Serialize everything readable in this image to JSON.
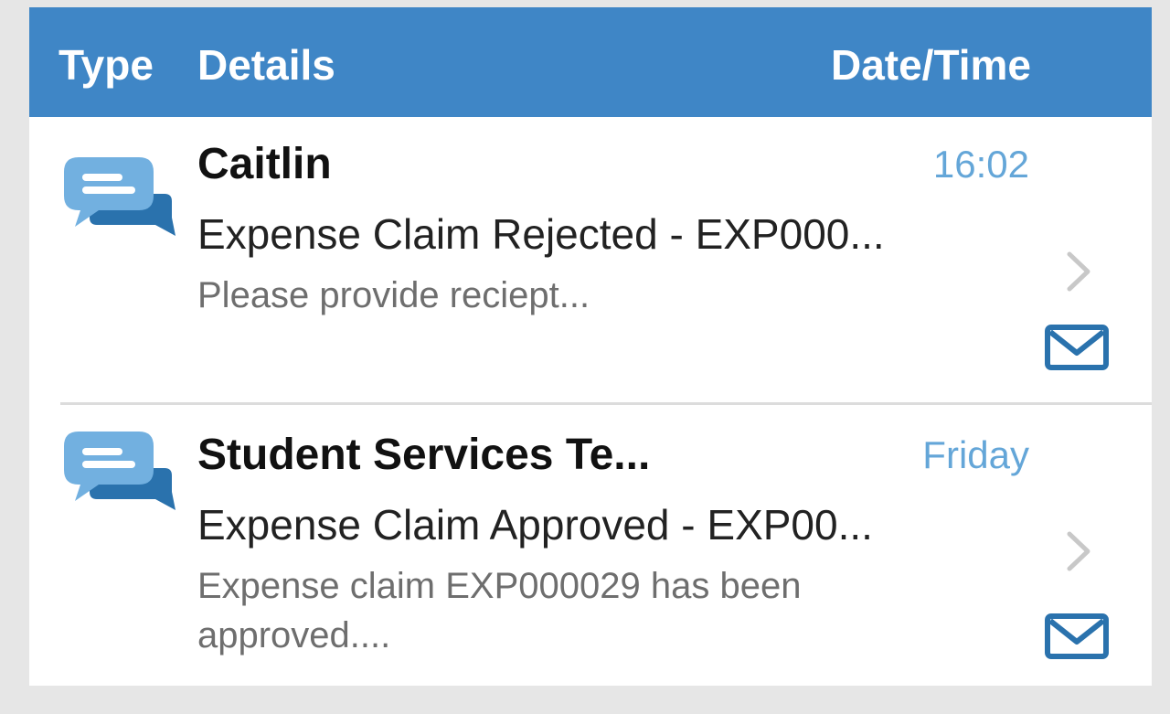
{
  "header": {
    "type_label": "Type",
    "details_label": "Details",
    "datetime_label": "Date/Time"
  },
  "messages": [
    {
      "sender": "Caitlin",
      "time": "16:02",
      "subject": "Expense Claim Rejected - EXP000...",
      "preview": "Please provide reciept...",
      "type_icon": "chat-bubbles-icon",
      "status_icon": "envelope-icon"
    },
    {
      "sender": "Student Services Te...",
      "time": "Friday",
      "subject": "Expense Claim Approved - EXP00...",
      "preview": "Expense claim EXP000029 has been approved....",
      "type_icon": "chat-bubbles-icon",
      "status_icon": "envelope-icon"
    }
  ],
  "colors": {
    "header_bg": "#3f86c6",
    "header_text": "#ffffff",
    "time_text": "#64a6d8",
    "icon_light_blue": "#72b0e0",
    "icon_dark_blue": "#2a72ad",
    "page_bg": "#e6e6e6"
  }
}
